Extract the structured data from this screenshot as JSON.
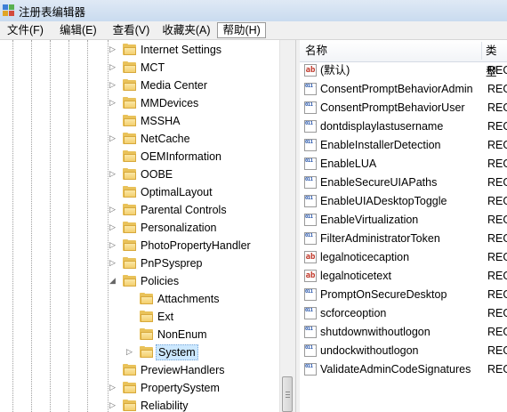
{
  "window": {
    "title": "注册表编辑器",
    "app_icon": "registry-editor-icon"
  },
  "menu": [
    {
      "label": "文件(F)"
    },
    {
      "label": "编辑(E)"
    },
    {
      "label": "查看(V)"
    },
    {
      "label": "收藏夹(A)"
    },
    {
      "label": "帮助(H)"
    }
  ],
  "tree": {
    "nodes": [
      {
        "label": "Internet Settings",
        "expander": "collapsed"
      },
      {
        "label": "MCT",
        "expander": "collapsed"
      },
      {
        "label": "Media Center",
        "expander": "collapsed"
      },
      {
        "label": "MMDevices",
        "expander": "collapsed"
      },
      {
        "label": "MSSHA",
        "expander": "none"
      },
      {
        "label": "NetCache",
        "expander": "collapsed"
      },
      {
        "label": "OEMInformation",
        "expander": "none"
      },
      {
        "label": "OOBE",
        "expander": "collapsed"
      },
      {
        "label": "OptimalLayout",
        "expander": "none"
      },
      {
        "label": "Parental Controls",
        "expander": "collapsed"
      },
      {
        "label": "Personalization",
        "expander": "collapsed"
      },
      {
        "label": "PhotoPropertyHandler",
        "expander": "collapsed"
      },
      {
        "label": "PnPSysprep",
        "expander": "collapsed"
      },
      {
        "label": "Policies",
        "expander": "expanded"
      },
      {
        "label": "Attachments",
        "expander": "none"
      },
      {
        "label": "Ext",
        "expander": "none"
      },
      {
        "label": "NonEnum",
        "expander": "none"
      },
      {
        "label": "System",
        "expander": "collapsed",
        "selected": true
      },
      {
        "label": "PreviewHandlers",
        "expander": "none"
      },
      {
        "label": "PropertySystem",
        "expander": "collapsed"
      },
      {
        "label": "Reliability",
        "expander": "collapsed"
      }
    ]
  },
  "list": {
    "columns": [
      {
        "label": "名称"
      },
      {
        "label": "类型"
      }
    ],
    "rows": [
      {
        "name": "(默认)",
        "icon": "string-value-icon",
        "type": "REG"
      },
      {
        "name": "ConsentPromptBehaviorAdmin",
        "icon": "dword-value-icon",
        "type": "REG"
      },
      {
        "name": "ConsentPromptBehaviorUser",
        "icon": "dword-value-icon",
        "type": "REG"
      },
      {
        "name": "dontdisplaylastusername",
        "icon": "dword-value-icon",
        "type": "REG"
      },
      {
        "name": "EnableInstallerDetection",
        "icon": "dword-value-icon",
        "type": "REG"
      },
      {
        "name": "EnableLUA",
        "icon": "dword-value-icon",
        "type": "REG"
      },
      {
        "name": "EnableSecureUIAPaths",
        "icon": "dword-value-icon",
        "type": "REG"
      },
      {
        "name": "EnableUIADesktopToggle",
        "icon": "dword-value-icon",
        "type": "REG"
      },
      {
        "name": "EnableVirtualization",
        "icon": "dword-value-icon",
        "type": "REG"
      },
      {
        "name": "FilterAdministratorToken",
        "icon": "dword-value-icon",
        "type": "REG"
      },
      {
        "name": "legalnoticecaption",
        "icon": "string-value-icon",
        "type": "REG"
      },
      {
        "name": "legalnoticetext",
        "icon": "string-value-icon",
        "type": "REG"
      },
      {
        "name": "PromptOnSecureDesktop",
        "icon": "dword-value-icon",
        "type": "REG"
      },
      {
        "name": "scforceoption",
        "icon": "dword-value-icon",
        "type": "REG"
      },
      {
        "name": "shutdownwithoutlogon",
        "icon": "dword-value-icon",
        "type": "REG"
      },
      {
        "name": "undockwithoutlogon",
        "icon": "dword-value-icon",
        "type": "REG"
      },
      {
        "name": "ValidateAdminCodeSignatures",
        "icon": "dword-value-icon",
        "type": "REG"
      }
    ]
  },
  "icons": {
    "folder": "folder-icon",
    "string_glyph": "ab",
    "dword_glyph": "011 110"
  },
  "colors": {
    "selection": "#cce8ff",
    "folder": "#e9c25a",
    "string_icon": "#c0392b",
    "dword_icon": "#1f4fa8"
  }
}
